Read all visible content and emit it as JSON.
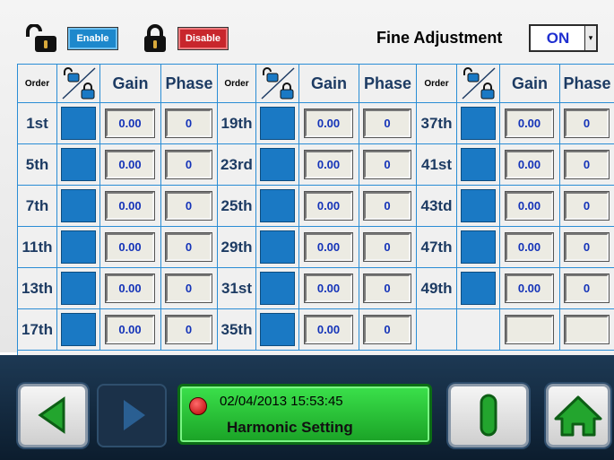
{
  "toolbar": {
    "enable_label": "Enable",
    "disable_label": "Disable",
    "fine_adjustment_label": "Fine Adjustment",
    "fine_adjustment_value": "ON"
  },
  "table": {
    "headers": {
      "order": "Order",
      "gain": "Gain",
      "phase": "Phase"
    },
    "col_groups": [
      {
        "orders": [
          "1st",
          "5th",
          "7th",
          "11th",
          "13th",
          "17th"
        ],
        "gains": [
          "0.00",
          "0.00",
          "0.00",
          "0.00",
          "0.00",
          "0.00"
        ],
        "phases": [
          "0",
          "0",
          "0",
          "0",
          "0",
          "0"
        ]
      },
      {
        "orders": [
          "19th",
          "23rd",
          "25th",
          "29th",
          "31st",
          "35th"
        ],
        "gains": [
          "0.00",
          "0.00",
          "0.00",
          "0.00",
          "0.00",
          "0.00"
        ],
        "phases": [
          "0",
          "0",
          "0",
          "0",
          "0",
          "0"
        ]
      },
      {
        "orders": [
          "37th",
          "41st",
          "43td",
          "47th",
          "49th",
          ""
        ],
        "gains": [
          "0.00",
          "0.00",
          "0.00",
          "0.00",
          "0.00",
          ""
        ],
        "phases": [
          "0",
          "0",
          "0",
          "0",
          "0",
          ""
        ]
      }
    ]
  },
  "status": {
    "datetime": "02/04/2013  15:53:45",
    "title": "Harmonic Setting"
  },
  "colors": {
    "accent_blue": "#1a79c4",
    "status_green": "#2ccc3a",
    "disable_red": "#c8262c"
  }
}
